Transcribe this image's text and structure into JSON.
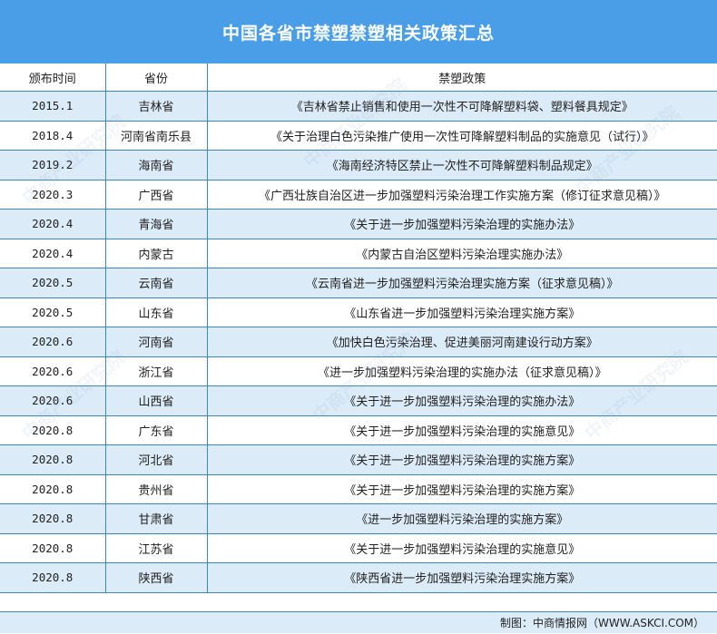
{
  "title": "中国各省市禁塑禁塑相关政策汇总",
  "headers": [
    "颁布时间",
    "省份",
    "禁塑政策"
  ],
  "rows": [
    [
      "2015.1",
      "吉林省",
      "《吉林省禁止销售和使用一次性不可降解塑料袋、塑料餐具规定》"
    ],
    [
      "2018.4",
      "河南省南乐县",
      "《关于治理白色污染推广使用一次性可降解塑料制品的实施意见（试行）》"
    ],
    [
      "2019.2",
      "海南省",
      "《海南经济特区禁止一次性不可降解塑料制品规定》"
    ],
    [
      "2020.3",
      "广西省",
      "《广西壮族自治区进一步加强塑料污染治理工作实施方案（修订征求意见稿）》"
    ],
    [
      "2020.4",
      "青海省",
      "《关于进一步加强塑料污染治理的实施办法》"
    ],
    [
      "2020.4",
      "内蒙古",
      "《内蒙古自治区塑料污染治理实施办法》"
    ],
    [
      "2020.5",
      "云南省",
      "《云南省进一步加强塑料污染治理实施方案（征求意见稿）》"
    ],
    [
      "2020.5",
      "山东省",
      "《山东省进一步加强塑料污染治理实施方案》"
    ],
    [
      "2020.6",
      "河南省",
      "《加快白色污染治理、促进美丽河南建设行动方案》"
    ],
    [
      "2020.6",
      "浙江省",
      "《进一步加强塑料污染治理的实施办法（征求意见稿）》"
    ],
    [
      "2020.6",
      "山西省",
      "《关于进一步加强塑料污染治理的实施办法》"
    ],
    [
      "2020.8",
      "广东省",
      "《关于进一步加强塑料污染治理的实施意见》"
    ],
    [
      "2020.8",
      "河北省",
      "《关于进一步加强塑料污染治理的实施方案》"
    ],
    [
      "2020.8",
      "贵州省",
      "《关于进一步加强塑料污染治理的实施方案》"
    ],
    [
      "2020.8",
      "甘肃省",
      "《进一步加强塑料污染治理的实施方案》"
    ],
    [
      "2020.8",
      "江苏省",
      "《关于进一步加强塑料污染治理的实施意见》"
    ],
    [
      "2020.8",
      "陕西省",
      "《陕西省进一步加强塑料污染治理实施方案》"
    ]
  ],
  "footer": "制图：中商情报网（WWW.ASKCI.COM）",
  "watermark": "中商产业研究院",
  "colors": {
    "header_bg": "#4a9ee8",
    "alt_row_bg": "#dcebf8",
    "border": "#3d85c6"
  }
}
